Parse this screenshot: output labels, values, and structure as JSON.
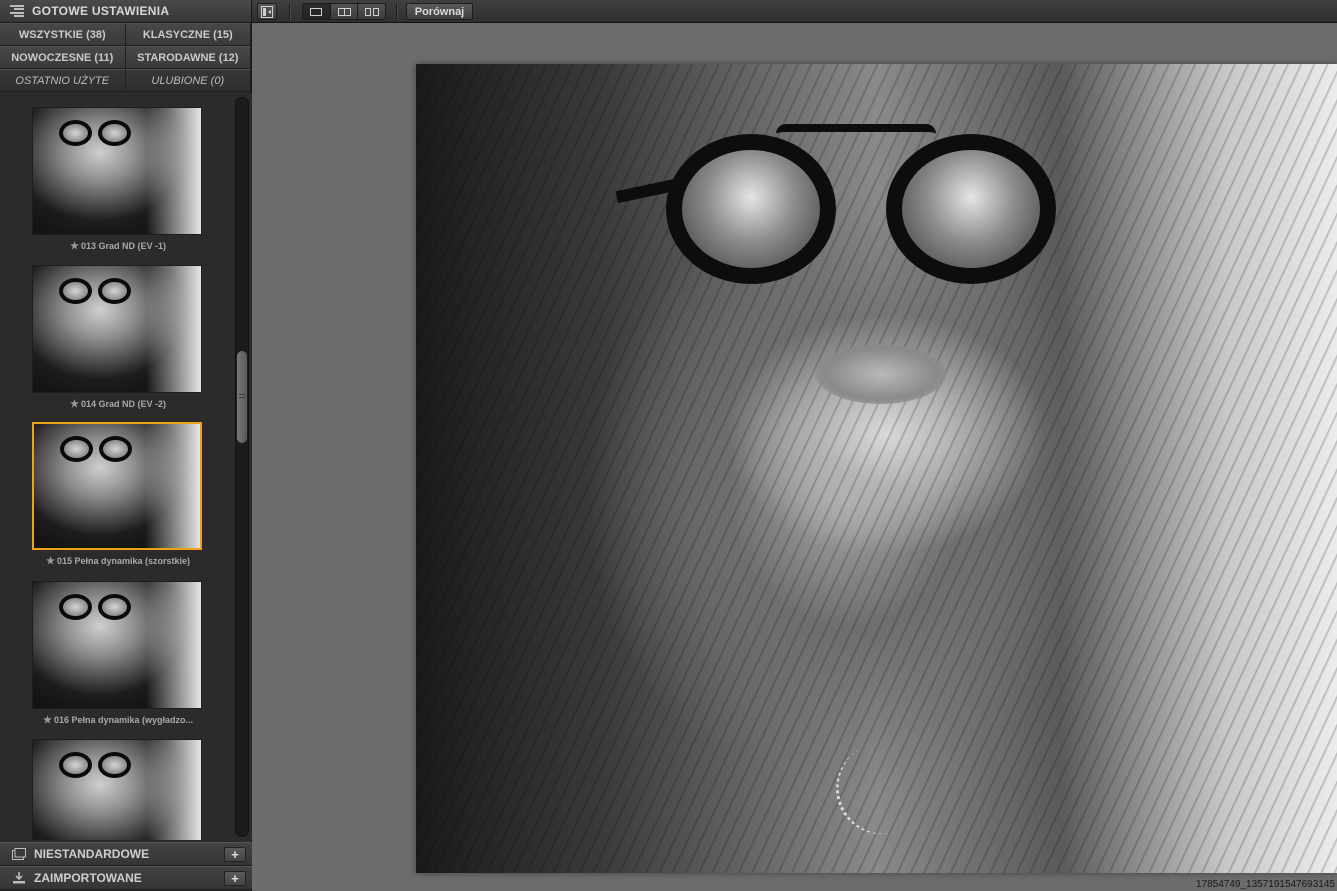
{
  "panel": {
    "title": "GOTOWE USTAWIENIA",
    "filters": [
      {
        "label": "WSZYSTKIE (38)"
      },
      {
        "label": "KLASYCZNE (15)"
      },
      {
        "label": "NOWOCZESNE (11)"
      },
      {
        "label": "STARODAWNE (12)"
      },
      {
        "label": "OSTATNIO UŻYTE"
      },
      {
        "label": "ULUBIONE (0)"
      }
    ],
    "presets": [
      {
        "label": "013 Grad ND (EV -1)",
        "star": "★"
      },
      {
        "label": "014 Grad ND (EV -2)",
        "star": "★"
      },
      {
        "label": "015 Pełna dynamika (szorstkie)",
        "star": "★"
      },
      {
        "label": "016 Pełna dynamika (wygładzo...",
        "star": "★"
      },
      {
        "label": "",
        "star": ""
      }
    ],
    "sections": [
      {
        "label": "NIESTANDARDOWE",
        "add": "+",
        "icon": "folder-icon"
      },
      {
        "label": "ZAIMPORTOWANE",
        "add": "+",
        "icon": "import-icon"
      }
    ]
  },
  "toolbar": {
    "compare_label": "Porównaj",
    "view_modes": [
      "single-view-icon",
      "split-view-icon",
      "side-by-side-icon"
    ]
  },
  "image": {
    "filename": "17854749_1357191547693145"
  },
  "colors": {
    "selection": "#f0a11a",
    "panel_bg": "#2b2b2b",
    "canvas_bg": "#6c6c6c"
  }
}
